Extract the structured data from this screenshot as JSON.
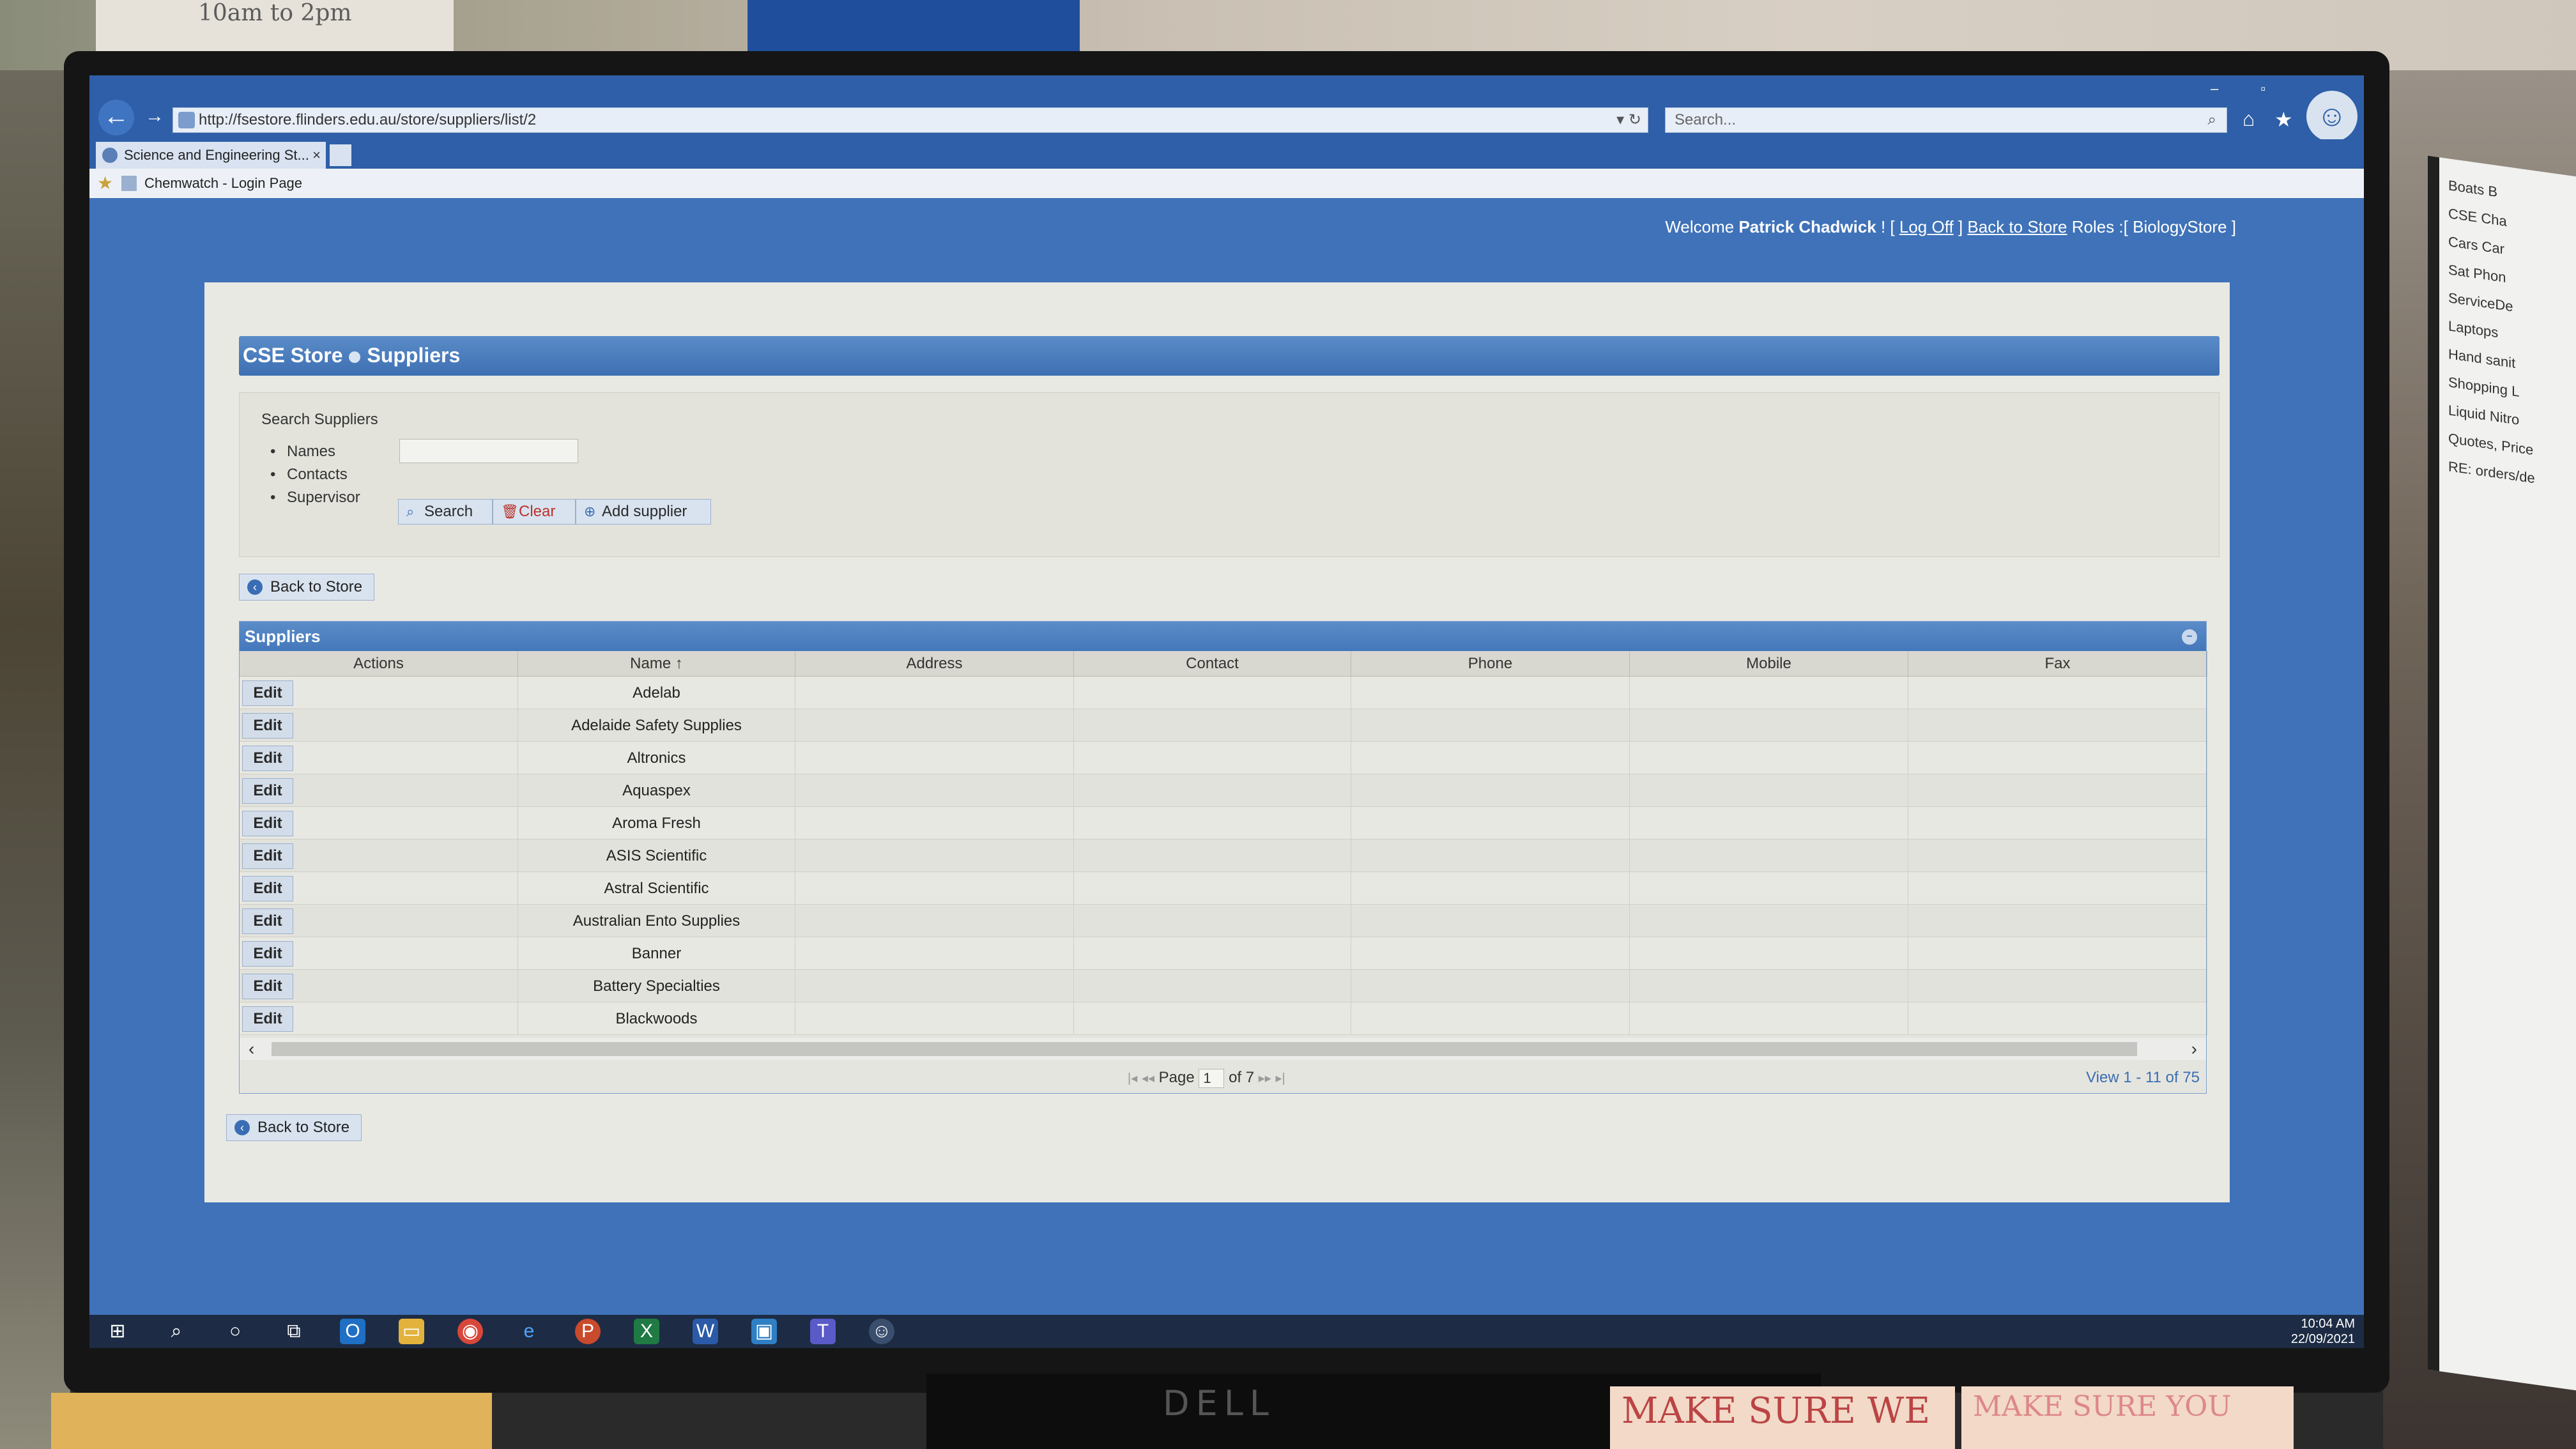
{
  "environment": {
    "top_note": "10am to 2pm",
    "sticky_note": "MAKE SURE WE",
    "sticky_note_2": "MAKE SURE YOU",
    "monitor_brand": "DELL",
    "side_monitor_items": [
      "Boats B",
      "CSE Cha",
      "Cars Car",
      "Sat Phon",
      "ServiceDe",
      "Laptops",
      "Hand sanit",
      "Shopping L",
      "Liquid Nitro",
      "Quotes, Price",
      "RE: orders/de"
    ]
  },
  "browser": {
    "url": "http://fsestore.flinders.edu.au/store/suppliers/list/2",
    "search_placeholder": "Search...",
    "tab_title": "Science and Engineering St...",
    "tab_close": "×",
    "favorite": "Chemwatch - Login Page",
    "icons": {
      "back": "←",
      "forward": "→",
      "home": "⌂",
      "star": "★",
      "search": "⌕",
      "gear": "☺"
    }
  },
  "header": {
    "welcome_prefix": "Welcome",
    "user_name": "Patrick Chadwick",
    "exclaim": "! [",
    "log_off": "Log Off",
    "close_bracket": "]",
    "back_to_store": "Back to Store",
    "roles_prefix": "Roles :[",
    "role": "BiologyStore",
    "roles_suffix": "]"
  },
  "page": {
    "breadcrumb_store": "CSE Store",
    "breadcrumb_page": "Suppliers",
    "search_label": "Search Suppliers",
    "criteria": [
      "Names",
      "Contacts",
      "Supervisor"
    ],
    "names_value": "",
    "buttons": {
      "search": "Search",
      "clear": "Clear",
      "add": "Add supplier"
    },
    "back_to_store": "Back to Store"
  },
  "grid": {
    "caption": "Suppliers",
    "columns": [
      "Actions",
      "Name ↑",
      "Address",
      "Contact",
      "Phone",
      "Mobile",
      "Fax"
    ],
    "edit_label": "Edit",
    "rows": [
      {
        "name": "Adelab"
      },
      {
        "name": "Adelaide Safety Supplies"
      },
      {
        "name": "Altronics"
      },
      {
        "name": "Aquaspex"
      },
      {
        "name": "Aroma Fresh"
      },
      {
        "name": "ASIS Scientific"
      },
      {
        "name": "Astral Scientific"
      },
      {
        "name": "Australian Ento Supplies"
      },
      {
        "name": "Banner"
      },
      {
        "name": "Battery Specialties"
      },
      {
        "name": "Blackwoods"
      }
    ],
    "pager": {
      "page_label": "Page",
      "page_value": "1",
      "of_label": "of 7",
      "view": "View 1 - 11 of 75"
    }
  },
  "taskbar": {
    "time": "10:04 AM",
    "date": "22/09/2021"
  }
}
